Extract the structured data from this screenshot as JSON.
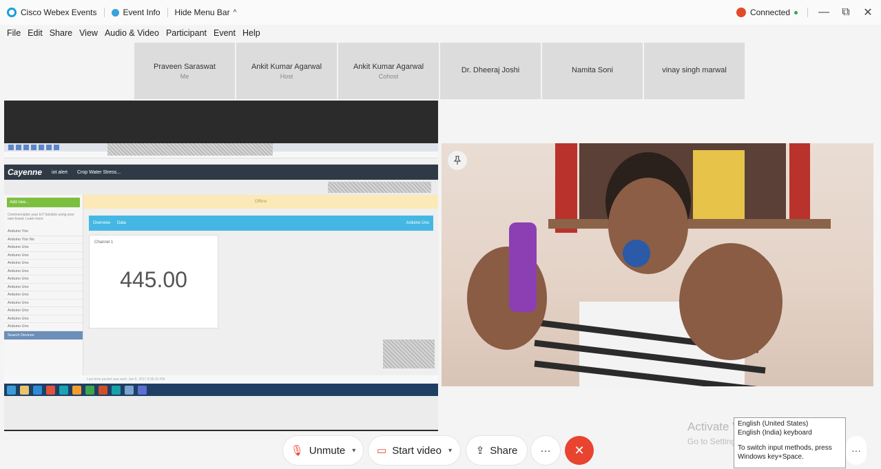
{
  "titlebar": {
    "app_name": "Cisco Webex Events",
    "event_info": "Event Info",
    "hide_menu_bar": "Hide Menu Bar",
    "caret_up": "^",
    "connection_status": "Connected",
    "minimize": "—",
    "restore": "⧉",
    "close": "✕"
  },
  "menu": [
    "File",
    "Edit",
    "Share",
    "View",
    "Audio & Video",
    "Participant",
    "Event",
    "Help"
  ],
  "participants": [
    {
      "name": "Praveen Saraswat",
      "role": "Me"
    },
    {
      "name": "Ankit Kumar Agarwal",
      "role": "Host"
    },
    {
      "name": "Ankit Kumar Agarwal",
      "role": "Cohost"
    },
    {
      "name": "Dr. Dheeraj Joshi",
      "role": ""
    },
    {
      "name": "Namita Soni",
      "role": ""
    },
    {
      "name": "vinay singh marwal",
      "role": ""
    }
  ],
  "shared_screen": {
    "cayenne_logo": "Cayenne",
    "project_tab": "iot alert",
    "project_name": "Crop Water Stress...",
    "add_new": "Add new...",
    "sidebar_hint": "Commercialize your IoT Solution using your own brand. Learn more",
    "sidebar_items": [
      "Arduino Yún",
      "Arduino Yún No",
      "Arduino Uno",
      "Arduino Uno",
      "Arduino Uno",
      "Arduino Uno",
      "Arduino Uno",
      "Arduino Uno",
      "Arduino Uno",
      "Arduino Uno",
      "Arduino Uno",
      "Arduino Uno",
      "Arduino Uno"
    ],
    "search_devices": "Search Devices",
    "offline_label": "Offline",
    "tab_overview": "Overview",
    "tab_data": "Data",
    "device_name": "Arduino Uno",
    "widget_title": "Channel 1",
    "widget_value": "445.00",
    "footer_text": "Last time packet was sent: Jan 6, 2017 8:35:31 PM"
  },
  "controls": {
    "unmute": "Unmute",
    "start_video": "Start video",
    "share": "Share",
    "more": "···",
    "end": "✕"
  },
  "watermark": {
    "line1": "Activate Windows",
    "line2": "Go to Settings to activate Windows."
  },
  "ime_tooltip": {
    "line1": "English (United States)",
    "line2": "English (India) keyboard",
    "line3": "To switch input methods, press Windows key+Space."
  },
  "colors": {
    "cayenne_header": "#2f3a46",
    "tab_blue": "#44b8e2",
    "add_green": "#7cbf3f",
    "end_red": "#e9442f"
  }
}
